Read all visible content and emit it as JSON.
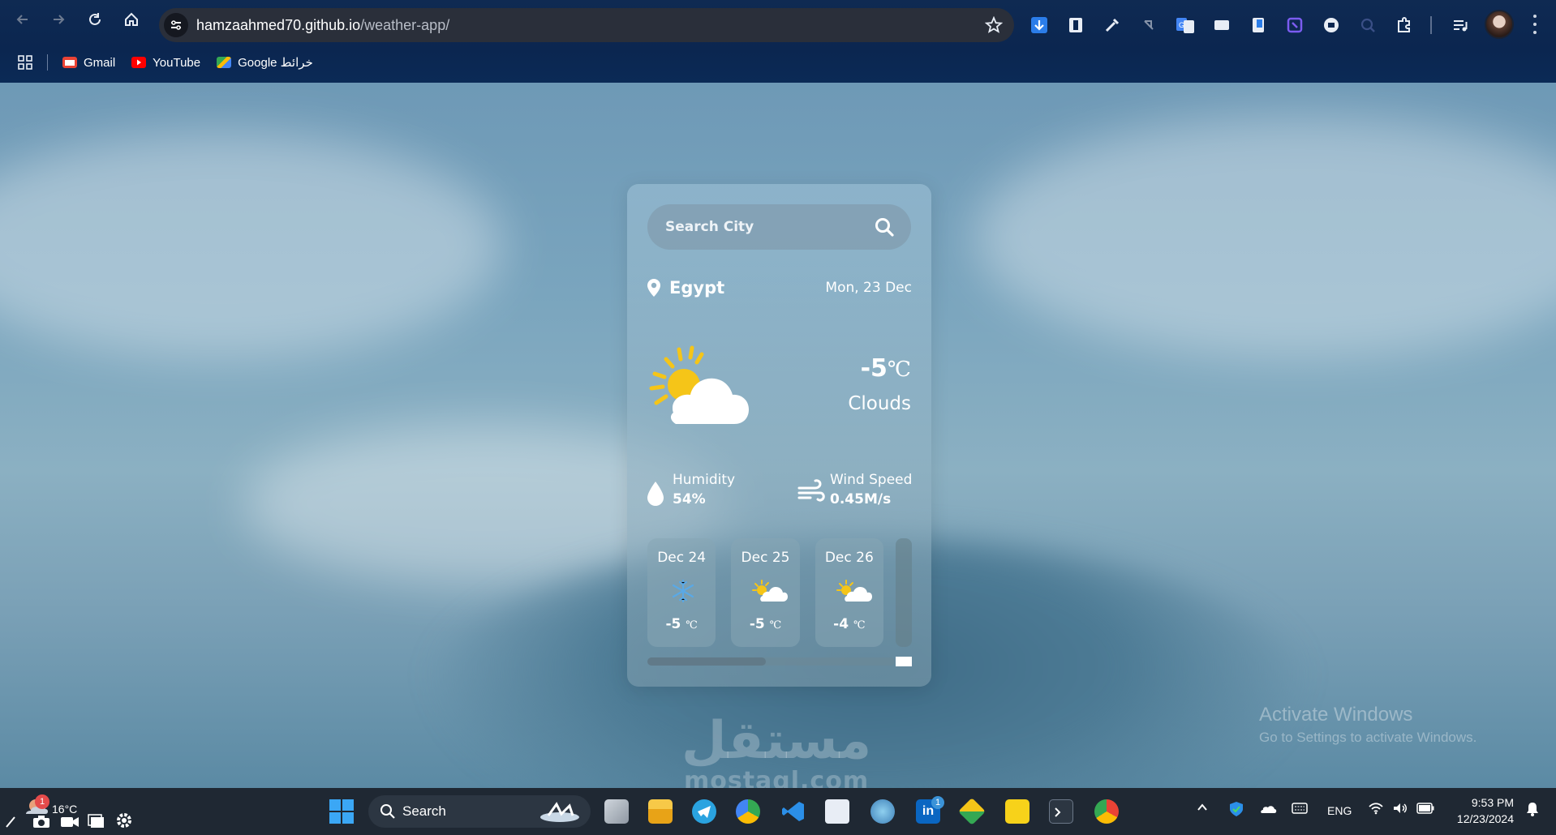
{
  "browser": {
    "url_host": "hamzaahmed70.github.io",
    "url_path": "/weather-app/",
    "bookmarks": [
      {
        "label": "Gmail",
        "icon": "gmail-icon",
        "color": "#ea4335"
      },
      {
        "label": "YouTube",
        "icon": "youtube-icon",
        "color": "#ff0000"
      },
      {
        "label": "Google خرائط",
        "icon": "maps-icon",
        "color": "#34a853"
      }
    ]
  },
  "weather": {
    "search_placeholder": "Search City",
    "city": "Egypt",
    "date": "Mon, 23 Dec",
    "temperature": "-5",
    "temperature_unit": "℃",
    "condition": "Clouds",
    "humidity_label": "Humidity",
    "humidity_value": "54%",
    "wind_label": "Wind Speed",
    "wind_value": "0.45M/s",
    "forecast": [
      {
        "date": "Dec 24",
        "icon": "snowflake-icon",
        "temp": "-5",
        "unit": "℃"
      },
      {
        "date": "Dec 25",
        "icon": "partly-cloudy-icon",
        "temp": "-5",
        "unit": "℃"
      },
      {
        "date": "Dec 26",
        "icon": "partly-cloudy-icon",
        "temp": "-4",
        "unit": "℃"
      }
    ],
    "horizontal_scroll_fraction": 0.48
  },
  "overlay": {
    "activate_title": "Activate Windows",
    "activate_sub": "Go to Settings to activate Windows.",
    "watermark_ar": "مستقل",
    "watermark_en": "mostaql.com"
  },
  "taskbar": {
    "weather_temp": "16°C",
    "notification_count": "1",
    "search_label": "Search",
    "lang": "ENG",
    "time": "9:53 PM",
    "date": "12/23/2024",
    "linkedin_badge": "1"
  }
}
